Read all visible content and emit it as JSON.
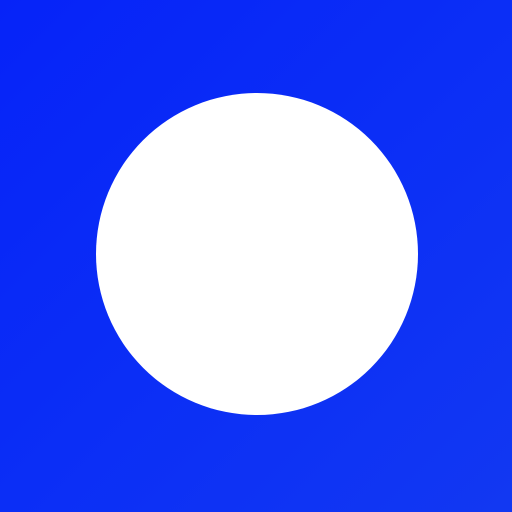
{
  "icon": {
    "name": "circle-icon",
    "shape": "circle",
    "colors": {
      "background": "#0a2cf4",
      "foreground": "#ffffff"
    }
  }
}
